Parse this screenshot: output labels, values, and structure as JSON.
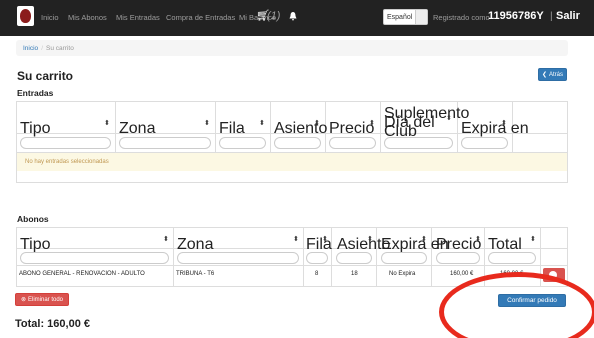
{
  "navbar": {
    "links": [
      "Inicio",
      "Mis Abonos",
      "Mis Entradas",
      "Compra de Entradas",
      "Mi Balance"
    ],
    "cart_count": "(1)",
    "language": "Español",
    "registered_label": "Registrado como",
    "user_id": "11956786Y",
    "separator": "|",
    "logout": "Salir"
  },
  "breadcrumb": {
    "home": "Inicio",
    "separator": "/",
    "current": "Su carrito"
  },
  "page_title": "Su carrito",
  "back_button": "Atrás",
  "entradas": {
    "title": "Entradas",
    "headers": [
      "Tipo",
      "Zona",
      "Fila",
      "Asiento",
      "Precio",
      "Suplemento Día del Club",
      "Expira en"
    ],
    "empty_message": "No hay entradas seleccionadas"
  },
  "abonos": {
    "title": "Abonos",
    "headers": [
      "Tipo",
      "Zona",
      "Fila",
      "Asiento",
      "Expira en",
      "Precio",
      "Total"
    ],
    "rows": [
      {
        "tipo": "ABONO GENERAL - RENOVACION - ADULTO",
        "zona": "TRIBUNA - T6",
        "fila": "8",
        "asiento": "18",
        "expira": "No Expira",
        "precio": "160,00 €",
        "total": "160,00 €"
      }
    ]
  },
  "clear_all_button": "Eliminar todo",
  "confirm_button": "Confirmar pedido",
  "total": "Total: 160,00 €",
  "colors": {
    "navbar": "#222222",
    "primary": "#337ab7",
    "danger": "#d9534f",
    "warning_bg": "#fcf8e3",
    "annotation": "#e82a1d"
  }
}
